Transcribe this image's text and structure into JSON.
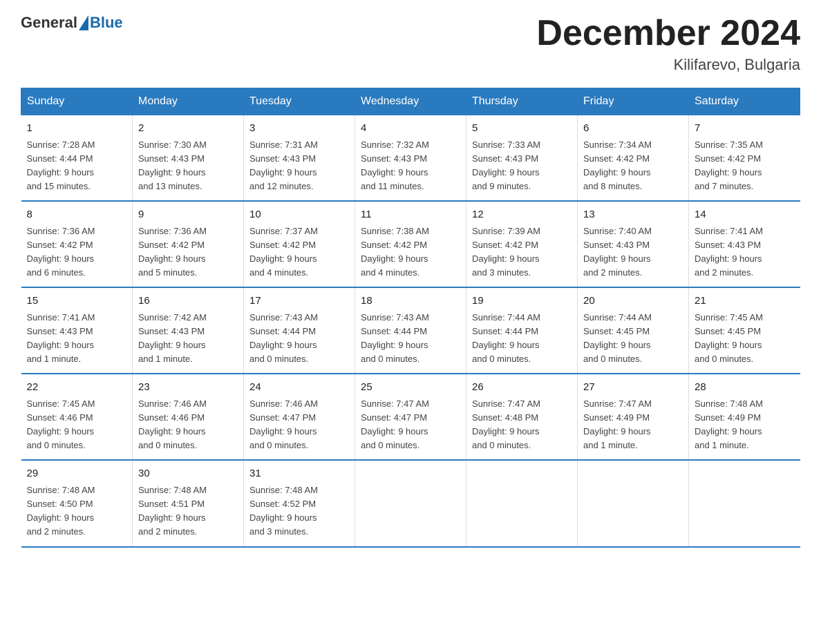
{
  "header": {
    "logo_general": "General",
    "logo_blue": "Blue",
    "month_title": "December 2024",
    "location": "Kilifarevo, Bulgaria"
  },
  "weekdays": [
    "Sunday",
    "Monday",
    "Tuesday",
    "Wednesday",
    "Thursday",
    "Friday",
    "Saturday"
  ],
  "weeks": [
    [
      {
        "day": "1",
        "sunrise": "7:28 AM",
        "sunset": "4:44 PM",
        "daylight": "9 hours and 15 minutes."
      },
      {
        "day": "2",
        "sunrise": "7:30 AM",
        "sunset": "4:43 PM",
        "daylight": "9 hours and 13 minutes."
      },
      {
        "day": "3",
        "sunrise": "7:31 AM",
        "sunset": "4:43 PM",
        "daylight": "9 hours and 12 minutes."
      },
      {
        "day": "4",
        "sunrise": "7:32 AM",
        "sunset": "4:43 PM",
        "daylight": "9 hours and 11 minutes."
      },
      {
        "day": "5",
        "sunrise": "7:33 AM",
        "sunset": "4:43 PM",
        "daylight": "9 hours and 9 minutes."
      },
      {
        "day": "6",
        "sunrise": "7:34 AM",
        "sunset": "4:42 PM",
        "daylight": "9 hours and 8 minutes."
      },
      {
        "day": "7",
        "sunrise": "7:35 AM",
        "sunset": "4:42 PM",
        "daylight": "9 hours and 7 minutes."
      }
    ],
    [
      {
        "day": "8",
        "sunrise": "7:36 AM",
        "sunset": "4:42 PM",
        "daylight": "9 hours and 6 minutes."
      },
      {
        "day": "9",
        "sunrise": "7:36 AM",
        "sunset": "4:42 PM",
        "daylight": "9 hours and 5 minutes."
      },
      {
        "day": "10",
        "sunrise": "7:37 AM",
        "sunset": "4:42 PM",
        "daylight": "9 hours and 4 minutes."
      },
      {
        "day": "11",
        "sunrise": "7:38 AM",
        "sunset": "4:42 PM",
        "daylight": "9 hours and 4 minutes."
      },
      {
        "day": "12",
        "sunrise": "7:39 AM",
        "sunset": "4:42 PM",
        "daylight": "9 hours and 3 minutes."
      },
      {
        "day": "13",
        "sunrise": "7:40 AM",
        "sunset": "4:43 PM",
        "daylight": "9 hours and 2 minutes."
      },
      {
        "day": "14",
        "sunrise": "7:41 AM",
        "sunset": "4:43 PM",
        "daylight": "9 hours and 2 minutes."
      }
    ],
    [
      {
        "day": "15",
        "sunrise": "7:41 AM",
        "sunset": "4:43 PM",
        "daylight": "9 hours and 1 minute."
      },
      {
        "day": "16",
        "sunrise": "7:42 AM",
        "sunset": "4:43 PM",
        "daylight": "9 hours and 1 minute."
      },
      {
        "day": "17",
        "sunrise": "7:43 AM",
        "sunset": "4:44 PM",
        "daylight": "9 hours and 0 minutes."
      },
      {
        "day": "18",
        "sunrise": "7:43 AM",
        "sunset": "4:44 PM",
        "daylight": "9 hours and 0 minutes."
      },
      {
        "day": "19",
        "sunrise": "7:44 AM",
        "sunset": "4:44 PM",
        "daylight": "9 hours and 0 minutes."
      },
      {
        "day": "20",
        "sunrise": "7:44 AM",
        "sunset": "4:45 PM",
        "daylight": "9 hours and 0 minutes."
      },
      {
        "day": "21",
        "sunrise": "7:45 AM",
        "sunset": "4:45 PM",
        "daylight": "9 hours and 0 minutes."
      }
    ],
    [
      {
        "day": "22",
        "sunrise": "7:45 AM",
        "sunset": "4:46 PM",
        "daylight": "9 hours and 0 minutes."
      },
      {
        "day": "23",
        "sunrise": "7:46 AM",
        "sunset": "4:46 PM",
        "daylight": "9 hours and 0 minutes."
      },
      {
        "day": "24",
        "sunrise": "7:46 AM",
        "sunset": "4:47 PM",
        "daylight": "9 hours and 0 minutes."
      },
      {
        "day": "25",
        "sunrise": "7:47 AM",
        "sunset": "4:47 PM",
        "daylight": "9 hours and 0 minutes."
      },
      {
        "day": "26",
        "sunrise": "7:47 AM",
        "sunset": "4:48 PM",
        "daylight": "9 hours and 0 minutes."
      },
      {
        "day": "27",
        "sunrise": "7:47 AM",
        "sunset": "4:49 PM",
        "daylight": "9 hours and 1 minute."
      },
      {
        "day": "28",
        "sunrise": "7:48 AM",
        "sunset": "4:49 PM",
        "daylight": "9 hours and 1 minute."
      }
    ],
    [
      {
        "day": "29",
        "sunrise": "7:48 AM",
        "sunset": "4:50 PM",
        "daylight": "9 hours and 2 minutes."
      },
      {
        "day": "30",
        "sunrise": "7:48 AM",
        "sunset": "4:51 PM",
        "daylight": "9 hours and 2 minutes."
      },
      {
        "day": "31",
        "sunrise": "7:48 AM",
        "sunset": "4:52 PM",
        "daylight": "9 hours and 3 minutes."
      },
      null,
      null,
      null,
      null
    ]
  ],
  "labels": {
    "sunrise": "Sunrise:",
    "sunset": "Sunset:",
    "daylight": "Daylight:"
  }
}
